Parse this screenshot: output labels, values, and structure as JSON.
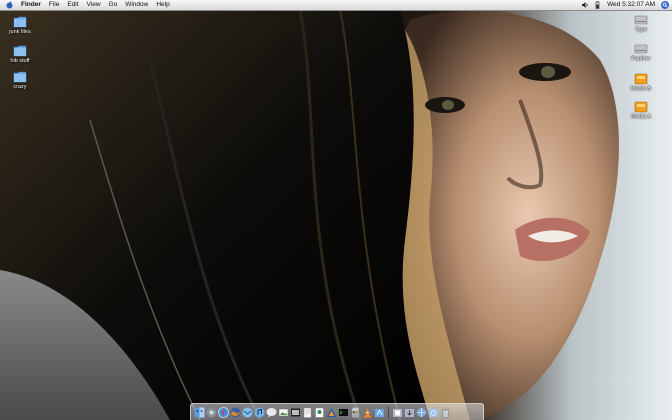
{
  "menubar": {
    "apple_icon": "apple-icon",
    "app_name": "Finder",
    "items": [
      "File",
      "Edit",
      "View",
      "Go",
      "Window",
      "Help"
    ],
    "status_icons": [
      "volume-icon",
      "battery-icon"
    ],
    "clock": "Wed 5:32:07 AM",
    "spotlight_icon": "spotlight-icon"
  },
  "desktop": {
    "left_icons": [
      {
        "label": "junk files",
        "icon": "folder-icon"
      },
      {
        "label": "hib stuff",
        "icon": "folder-icon"
      },
      {
        "label": "crazy",
        "icon": "folder-icon"
      }
    ],
    "right_icons": [
      {
        "label": "Tiger",
        "icon": "hard-drive-icon"
      },
      {
        "label": "Panther",
        "icon": "hard-drive-icon"
      },
      {
        "label": "Media B",
        "icon": "external-drive-icon"
      },
      {
        "label": "Media A",
        "icon": "external-drive-icon"
      }
    ]
  },
  "dock": {
    "apps": [
      "finder-icon",
      "system-preferences-icon",
      "safari-icon",
      "firefox-icon",
      "mail-icon",
      "itunes-icon",
      "ichat-icon",
      "iphoto-icon",
      "imovie-icon",
      "textedit-icon",
      "preview-icon",
      "photoshop-icon",
      "terminal-icon",
      "calculator-icon",
      "vlc-icon",
      "applications-icon"
    ],
    "stacks": [
      "documents-icon",
      "downloads-icon",
      "network-icon",
      "sites-icon",
      "trash-icon"
    ]
  },
  "colors": {
    "folder": "#6aa8e6",
    "drive_orange": "#f0a020",
    "drive_gray": "#b8b8c0"
  }
}
